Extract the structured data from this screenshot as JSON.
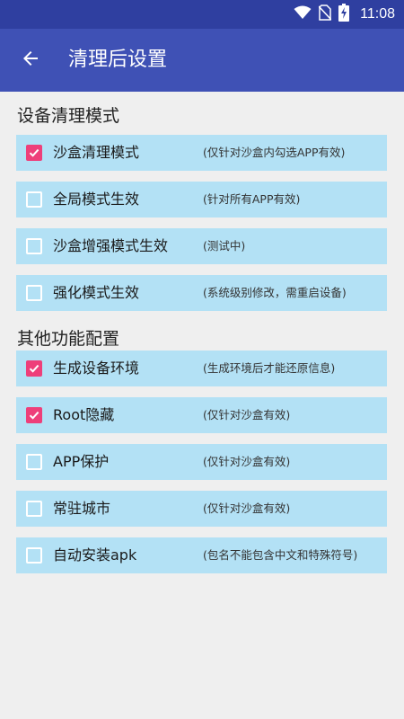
{
  "status_bar": {
    "time": "11:08",
    "icons": [
      "wifi-icon",
      "no-sim-icon",
      "battery-charging-icon"
    ]
  },
  "app_bar": {
    "title": "清理后设置",
    "back_icon": "arrow-back-icon"
  },
  "colors": {
    "status_bar": "#2f3fa0",
    "app_bar": "#3f51b5",
    "row_background": "#b3e1f5",
    "checkbox_checked": "#ee3f7a",
    "page_background": "#efefef"
  },
  "sections": [
    {
      "title": "设备清理模式",
      "items": [
        {
          "label": "沙盒清理模式",
          "note": "(仅针对沙盒内勾选APP有效)",
          "checked": true
        },
        {
          "label": "全局模式生效",
          "note": "(针对所有APP有效)",
          "checked": false
        },
        {
          "label": "沙盒增强模式生效",
          "note": "(测试中)",
          "checked": false
        },
        {
          "label": "强化模式生效",
          "note": "(系统级别修改，需重启设备)",
          "checked": false
        }
      ]
    },
    {
      "title": "其他功能配置",
      "items": [
        {
          "label": "生成设备环境",
          "note": "(生成环境后才能还原信息)",
          "checked": true
        },
        {
          "label": "Root隐藏",
          "note": "(仅针对沙盒有效)",
          "checked": true
        },
        {
          "label": "APP保护",
          "note": "(仅针对沙盒有效)",
          "checked": false
        },
        {
          "label": "常驻城市",
          "note": "(仅针对沙盒有效)",
          "checked": false
        },
        {
          "label": "自动安装apk",
          "note": "(包名不能包含中文和特殊符号)",
          "checked": false
        }
      ]
    }
  ]
}
